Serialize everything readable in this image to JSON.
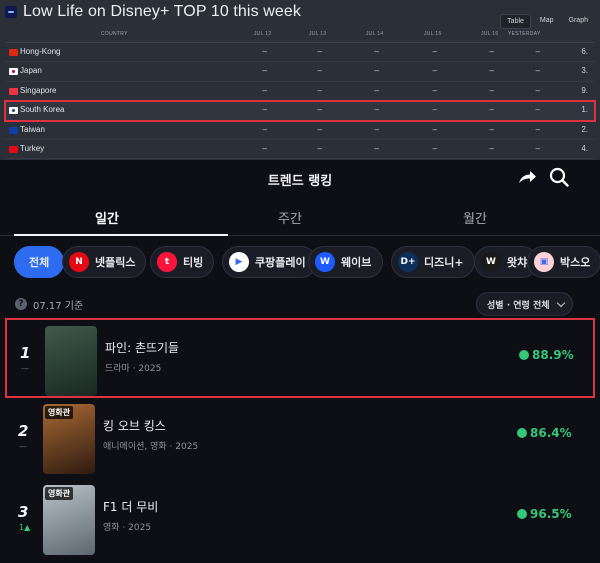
{
  "disney_panel": {
    "title": "Low Life on Disney+ TOP 10 this week",
    "view_tabs": [
      "Table",
      "Map",
      "Graph"
    ],
    "active_view": "Table",
    "columns": [
      "COUNTRY",
      "JUL 12",
      "JUL 13",
      "JUL 14",
      "JUL 15",
      "JUL 16",
      "YESTERDAY"
    ],
    "rows": [
      {
        "country": "Hong-Kong",
        "values": [
          "–",
          "–",
          "–",
          "–",
          "–",
          "–"
        ],
        "rank": "6.",
        "flag_color": "#de2910"
      },
      {
        "country": "Japan",
        "values": [
          "–",
          "–",
          "–",
          "–",
          "–",
          "–"
        ],
        "rank": "3.",
        "flag_color": "#ffffff"
      },
      {
        "country": "Singapore",
        "values": [
          "–",
          "–",
          "–",
          "–",
          "–",
          "–"
        ],
        "rank": "9.",
        "flag_color": "#ef3340"
      },
      {
        "country": "South Korea",
        "values": [
          "–",
          "–",
          "–",
          "–",
          "–",
          "–"
        ],
        "rank": "1.",
        "flag_color": "#ffffff",
        "highlighted": true
      },
      {
        "country": "Taiwan",
        "values": [
          "–",
          "–",
          "–",
          "–",
          "–",
          "–"
        ],
        "rank": "2.",
        "flag_color": "#0f3ea8"
      },
      {
        "country": "Turkey",
        "values": [
          "–",
          "–",
          "–",
          "–",
          "–",
          "–"
        ],
        "rank": "4.",
        "flag_color": "#e30a17"
      }
    ]
  },
  "app": {
    "title": "트렌드 랭킹",
    "share_icon": "share-icon",
    "search_icon": "search-icon",
    "tabs": [
      "일간",
      "주간",
      "월간"
    ],
    "active_tab": "일간",
    "platforms": [
      {
        "label": "전체",
        "icon": "",
        "color": "#2d6cf0",
        "active": true
      },
      {
        "label": "넷플릭스",
        "icon": "N",
        "color": "#e50914"
      },
      {
        "label": "티빙",
        "icon": "t",
        "color": "#ff153c"
      },
      {
        "label": "쿠팡플레이",
        "icon": "▶",
        "color": "#ffffff"
      },
      {
        "label": "웨이브",
        "icon": "W",
        "color": "#1f5cff"
      },
      {
        "label": "디즈니+",
        "icon": "D+",
        "color": "#0e2e5c"
      },
      {
        "label": "왓챠",
        "icon": "W",
        "color": "#1a1a1a"
      },
      {
        "label": "박스오",
        "icon": "▣",
        "color": "#ffd2d9"
      }
    ],
    "date_label": "07.17 기준",
    "filter_label": "성별 · 연령 전체",
    "ranking": [
      {
        "rank": "1",
        "change": "—",
        "change_up": false,
        "title": "파인: 촌뜨기들",
        "meta": "드라마 · 2025",
        "score": "88.9%",
        "badge": "",
        "poster_colors": [
          "#3f5a4a",
          "#1a2822"
        ],
        "highlighted": true
      },
      {
        "rank": "2",
        "change": "—",
        "change_up": false,
        "title": "킹 오브 킹스",
        "meta": "애니메이션, 영화 · 2025",
        "score": "86.4%",
        "badge": "영화관",
        "poster_colors": [
          "#a86a34",
          "#2e1a10"
        ]
      },
      {
        "rank": "3",
        "change": "1▲",
        "change_up": true,
        "title": "F1 더 무비",
        "meta": "영화 · 2025",
        "score": "96.5%",
        "badge": "영화관",
        "poster_colors": [
          "#b9c2c8",
          "#5b6770"
        ]
      }
    ]
  }
}
